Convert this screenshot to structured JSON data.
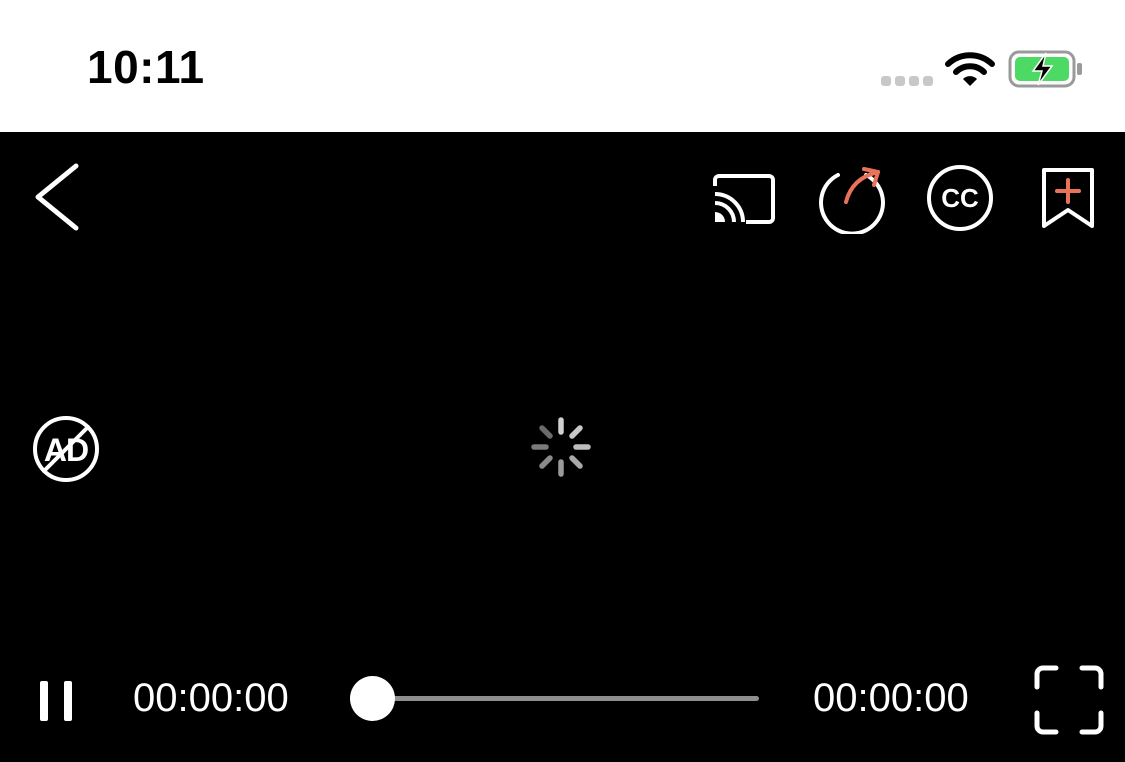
{
  "status_bar": {
    "time": "10:11",
    "signal_icon": "signal-dots-icon",
    "wifi_icon": "wifi-icon",
    "battery_icon": "battery-charging-icon"
  },
  "toolbar": {
    "back_icon": "chevron-left-icon",
    "cast_icon": "cast-icon",
    "share_icon": "share-arrow-icon",
    "captions_label": "CC",
    "bookmark_icon": "bookmark-add-icon"
  },
  "video": {
    "no_ad_label": "AD",
    "loading_icon": "spinner-icon"
  },
  "controls": {
    "pause_icon": "pause-icon",
    "current_time": "00:00:00",
    "total_time": "00:00:00",
    "progress": 0,
    "fullscreen_icon": "fullscreen-icon"
  },
  "colors": {
    "accent": "#E8735A",
    "battery_green": "#4CD964",
    "track": "#8E8E8E"
  }
}
